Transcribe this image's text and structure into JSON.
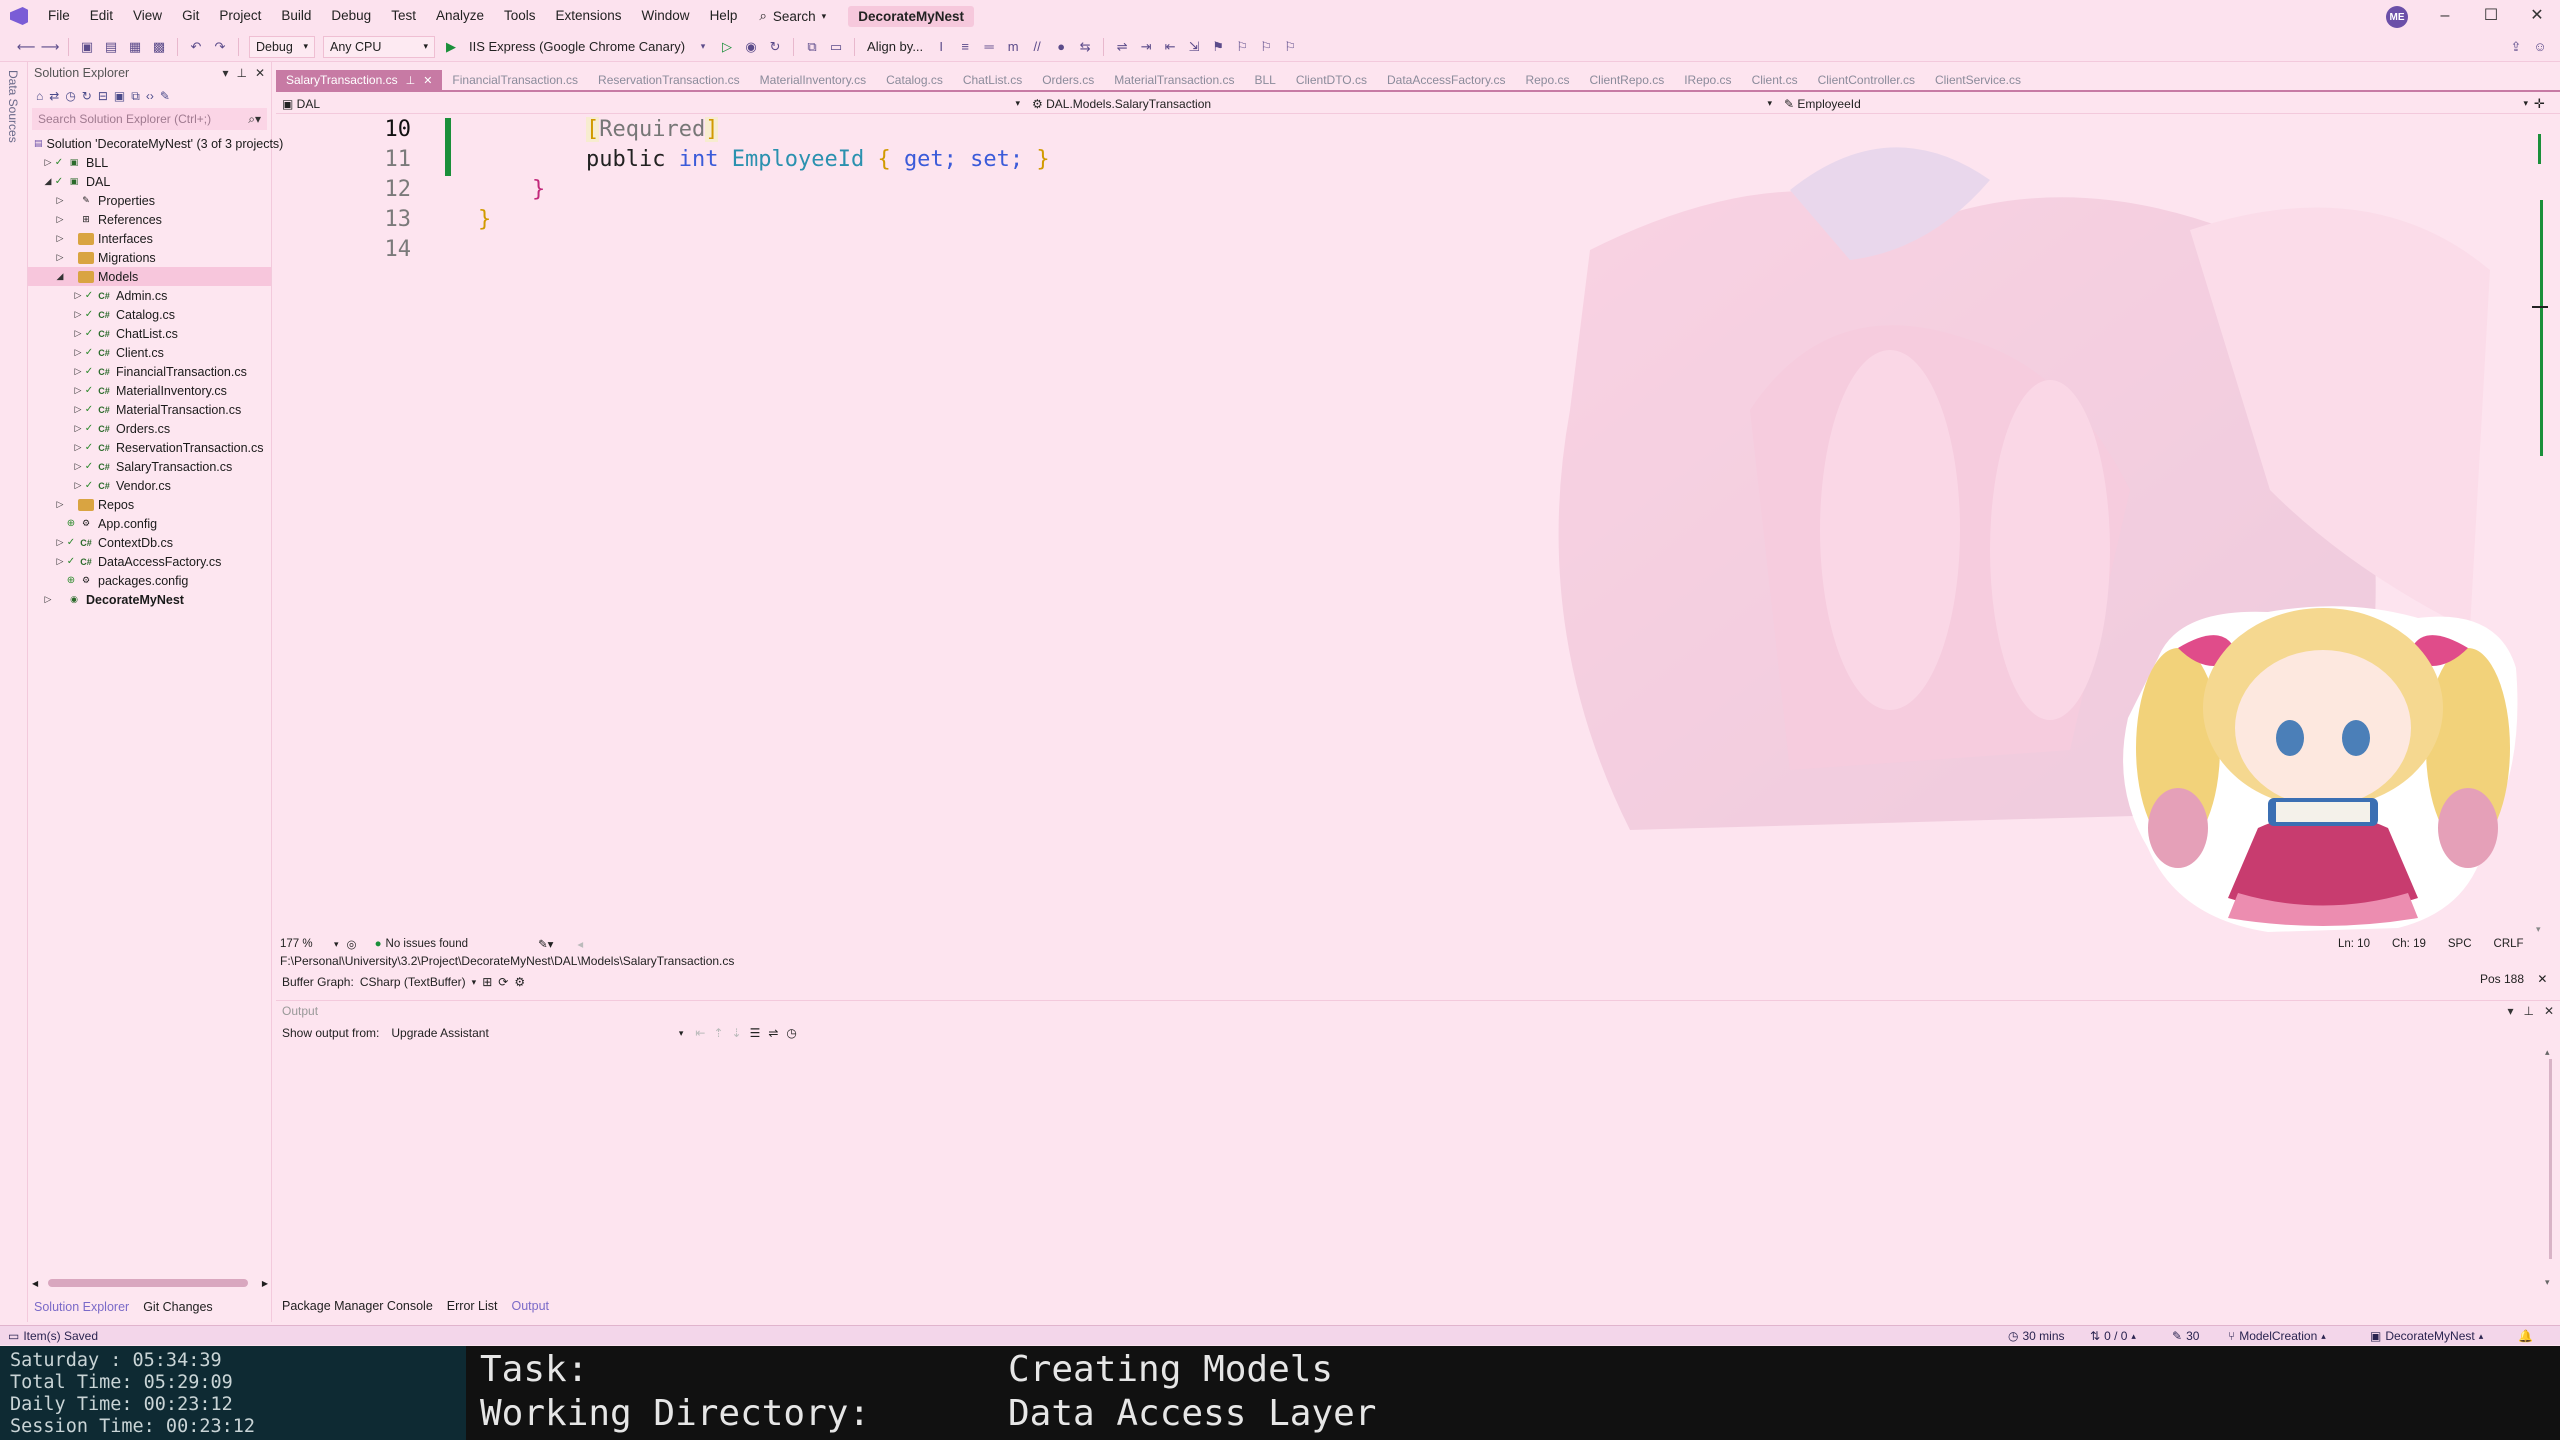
{
  "menubar": {
    "items": [
      "File",
      "Edit",
      "View",
      "Git",
      "Project",
      "Build",
      "Debug",
      "Test",
      "Analyze",
      "Tools",
      "Extensions",
      "Window",
      "Help"
    ],
    "search_label": "Search",
    "solution_name": "DecorateMyNest",
    "avatar_initials": "ME"
  },
  "toolbar": {
    "config": "Debug",
    "platform": "Any CPU",
    "run_target": "IIS Express (Google Chrome Canary)",
    "align_label": "Align by..."
  },
  "left_strip": {
    "label": "Data Sources"
  },
  "solution_explorer": {
    "title": "Solution Explorer",
    "search_placeholder": "Search Solution Explorer (Ctrl+;)",
    "tree": [
      {
        "label": "Solution 'DecorateMyNest' (3 of 3 projects)",
        "depth": 0,
        "arrow": "",
        "icon": "solution"
      },
      {
        "label": "BLL",
        "depth": 1,
        "arrow": "▷",
        "icon": "project"
      },
      {
        "label": "DAL",
        "depth": 1,
        "arrow": "◢",
        "icon": "project"
      },
      {
        "label": "Properties",
        "depth": 2,
        "arrow": "▷",
        "icon": "wrench"
      },
      {
        "label": "References",
        "depth": 2,
        "arrow": "▷",
        "icon": "refs"
      },
      {
        "label": "Interfaces",
        "depth": 2,
        "arrow": "▷",
        "icon": "folder"
      },
      {
        "label": "Migrations",
        "depth": 2,
        "arrow": "▷",
        "icon": "folder"
      },
      {
        "label": "Models",
        "depth": 2,
        "arrow": "◢",
        "icon": "folder"
      },
      {
        "label": "Admin.cs",
        "depth": 3,
        "arrow": "▷",
        "icon": "cs"
      },
      {
        "label": "Catalog.cs",
        "depth": 3,
        "arrow": "▷",
        "icon": "cs"
      },
      {
        "label": "ChatList.cs",
        "depth": 3,
        "arrow": "▷",
        "icon": "cs"
      },
      {
        "label": "Client.cs",
        "depth": 3,
        "arrow": "▷",
        "icon": "cs"
      },
      {
        "label": "FinancialTransaction.cs",
        "depth": 3,
        "arrow": "▷",
        "icon": "cs"
      },
      {
        "label": "MaterialInventory.cs",
        "depth": 3,
        "arrow": "▷",
        "icon": "cs"
      },
      {
        "label": "MaterialTransaction.cs",
        "depth": 3,
        "arrow": "▷",
        "icon": "cs"
      },
      {
        "label": "Orders.cs",
        "depth": 3,
        "arrow": "▷",
        "icon": "cs"
      },
      {
        "label": "ReservationTransaction.cs",
        "depth": 3,
        "arrow": "▷",
        "icon": "cs"
      },
      {
        "label": "SalaryTransaction.cs",
        "depth": 3,
        "arrow": "▷",
        "icon": "cs"
      },
      {
        "label": "Vendor.cs",
        "depth": 3,
        "arrow": "▷",
        "icon": "cs"
      },
      {
        "label": "Repos",
        "depth": 2,
        "arrow": "▷",
        "icon": "folder"
      },
      {
        "label": "App.config",
        "depth": 2,
        "arrow": "",
        "icon": "config"
      },
      {
        "label": "ContextDb.cs",
        "depth": 2,
        "arrow": "▷",
        "icon": "cs"
      },
      {
        "label": "DataAccessFactory.cs",
        "depth": 2,
        "arrow": "▷",
        "icon": "cs"
      },
      {
        "label": "packages.config",
        "depth": 2,
        "arrow": "",
        "icon": "config"
      },
      {
        "label": "DecorateMyNest",
        "depth": 1,
        "arrow": "▷",
        "icon": "web"
      }
    ],
    "bottom_tabs": [
      "Solution Explorer",
      "Git Changes"
    ]
  },
  "doc_tabs": [
    "SalaryTransaction.cs",
    "FinancialTransaction.cs",
    "ReservationTransaction.cs",
    "MaterialInventory.cs",
    "Catalog.cs",
    "ChatList.cs",
    "Orders.cs",
    "MaterialTransaction.cs",
    "BLL",
    "ClientDTO.cs",
    "DataAccessFactory.cs",
    "Repo.cs",
    "ClientRepo.cs",
    "IRepo.cs",
    "Client.cs",
    "ClientController.cs",
    "ClientService.cs"
  ],
  "navbar": {
    "project": "DAL",
    "type": "DAL.Models.SalaryTransaction",
    "member": "EmployeeId"
  },
  "code": {
    "lines": [
      {
        "num": "10",
        "current": true
      },
      {
        "num": "11"
      },
      {
        "num": "12"
      },
      {
        "num": "13"
      },
      {
        "num": "14"
      }
    ],
    "line10": {
      "bracket_open": "[",
      "attr": "Required",
      "bracket_close": "]"
    },
    "line11": {
      "kw1": "public",
      "kw2": "int",
      "ident": "EmployeeId",
      "brace_open": "{",
      "get": "get;",
      "set": "set;",
      "brace_close": "}"
    },
    "line12": {
      "brace": "}"
    },
    "line13": {
      "brace": "}"
    }
  },
  "editor_status": {
    "zoom": "177 %",
    "issues": "No issues found",
    "line": "Ln: 10",
    "char": "Ch: 19",
    "whitespace": "SPC",
    "line_ending": "CRLF"
  },
  "path": "F:\\Personal\\University\\3.2\\Project\\DecorateMyNest\\DAL\\Models\\SalaryTransaction.cs",
  "buffer_graph": {
    "label": "Buffer Graph:",
    "value": "CSharp (TextBuffer)",
    "pos": "Pos 188"
  },
  "output": {
    "title": "Output",
    "show_label": "Show output from:",
    "source": "Upgrade Assistant"
  },
  "bottom_tabs": [
    "Package Manager Console",
    "Error List",
    "Output"
  ],
  "statusbar": {
    "message": "Item(s) Saved",
    "timer": "30 mins",
    "git_sync": "0 / 0",
    "edits": "30",
    "branch": "ModelCreation",
    "repo": "DecorateMyNest"
  },
  "overlay": {
    "day": "Saturday  :  05:34:39",
    "total": "Total Time: 05:29:09",
    "daily": "Daily Time: 00:23:12",
    "session": "Session Time: 00:23:12",
    "task_label": "Task:",
    "task_value": "Creating Models",
    "dir_label": "Working Directory:",
    "dir_value": "Data Access Layer"
  },
  "colors": {
    "background": "#fde4ef",
    "accent": "#c77aa4",
    "change_bar": "#1a8f3a"
  }
}
